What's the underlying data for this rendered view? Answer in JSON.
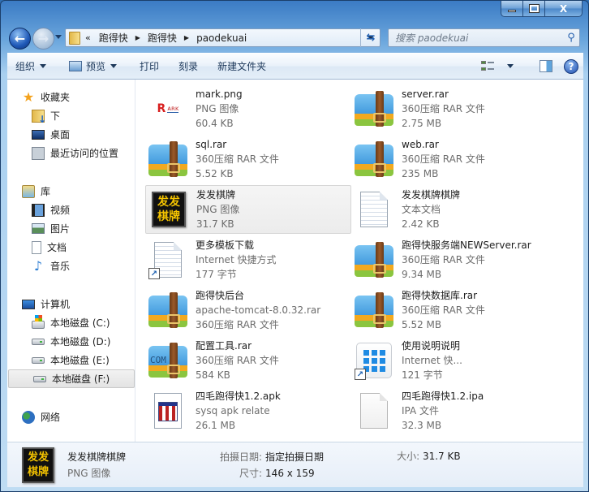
{
  "window": {
    "minimize_label": "",
    "maximize_label": "",
    "close_label": "X"
  },
  "nav": {
    "back_glyph": "←",
    "forward_glyph": "→",
    "address": {
      "overflow": "«",
      "crumbs": [
        "跑得快",
        "跑得快",
        "paodekuai"
      ]
    },
    "refresh_glyph": "⇆",
    "search": {
      "placeholder": "搜索 paodekuai",
      "value": ""
    }
  },
  "toolbar": {
    "organize": "组织",
    "preview": "预览",
    "print": "打印",
    "burn": "刻录",
    "new_folder": "新建文件夹",
    "help": "?"
  },
  "sidebar": {
    "favorites": {
      "label": "收藏夹",
      "items": [
        {
          "label": "下"
        },
        {
          "label": "桌面"
        },
        {
          "label": "最近访问的位置"
        }
      ]
    },
    "libraries": {
      "label": "库",
      "items": [
        {
          "label": "视频"
        },
        {
          "label": "图片"
        },
        {
          "label": "文档"
        },
        {
          "label": "音乐"
        }
      ]
    },
    "computer": {
      "label": "计算机",
      "items": [
        {
          "label": "本地磁盘 (C:)"
        },
        {
          "label": "本地磁盘 (D:)"
        },
        {
          "label": "本地磁盘 (E:)"
        },
        {
          "label": "本地磁盘 (F:)",
          "selected": true
        }
      ]
    },
    "network": {
      "label": "网络"
    }
  },
  "files": [
    {
      "icon": "png-image",
      "name": "mark.png",
      "line2": "PNG 图像",
      "line3": "60.4 KB"
    },
    {
      "icon": "rar-archive",
      "name": "server.rar",
      "line2": "360压缩 RAR 文件",
      "line3": "2.75 MB"
    },
    {
      "icon": "rar-archive",
      "name": "sql.rar",
      "line2": "360压缩 RAR 文件",
      "line3": "5.52 KB"
    },
    {
      "icon": "rar-archive",
      "name": "web.rar",
      "line2": "360压缩 RAR 文件",
      "line3": "235 MB"
    },
    {
      "icon": "png-image",
      "name": "发发棋牌",
      "line2": "PNG 图像",
      "line3": "31.7 KB",
      "selected": true
    },
    {
      "icon": "text-document",
      "name": "发发棋牌棋牌",
      "line2": "文本文档",
      "line3": "2.42 KB"
    },
    {
      "icon": "internet-shortcut",
      "name": "更多模板下载",
      "line2": "Internet 快捷方式",
      "line3": "177 字节"
    },
    {
      "icon": "rar-archive",
      "name": "跑得快服务端NEWServer.rar",
      "line2": "360压缩 RAR 文件",
      "line3": "9.34 MB"
    },
    {
      "icon": "rar-archive",
      "name": "跑得快后台",
      "line2": "apache-tomcat-8.0.32.rar",
      "line3": "360压缩 RAR 文件"
    },
    {
      "icon": "rar-archive",
      "name": "跑得快数据库.rar",
      "line2": "360压缩 RAR 文件",
      "line3": "5.52 MB"
    },
    {
      "icon": "rar-archive-com",
      "name": "配置工具.rar",
      "line2": "360压缩 RAR 文件",
      "line3": "584 KB"
    },
    {
      "icon": "app-shortcut",
      "name": "使用说明说明",
      "line2": "Internet 快...",
      "line3": "121 字节"
    },
    {
      "icon": "apk-file",
      "name": "四毛跑得快1.2.apk",
      "line2": "sysq apk relate",
      "line3": "26.1 MB"
    },
    {
      "icon": "blank-file",
      "name": "四毛跑得快1.2.ipa",
      "line2": "IPA 文件",
      "line3": "32.3 MB"
    }
  ],
  "thumb_text": {
    "top": "发发",
    "bottom": "棋牌"
  },
  "mark_thumb": {
    "r": "R",
    "b": "ᴀʀᴋ"
  },
  "details": {
    "name": "发发棋牌棋牌",
    "type": "PNG 图像",
    "date_label": "拍摄日期:",
    "date_value": "指定拍摄日期",
    "dims_label": "尺寸:",
    "dims_value": "146 x 159",
    "size_label": "大小:",
    "size_value": "31.7 KB"
  }
}
